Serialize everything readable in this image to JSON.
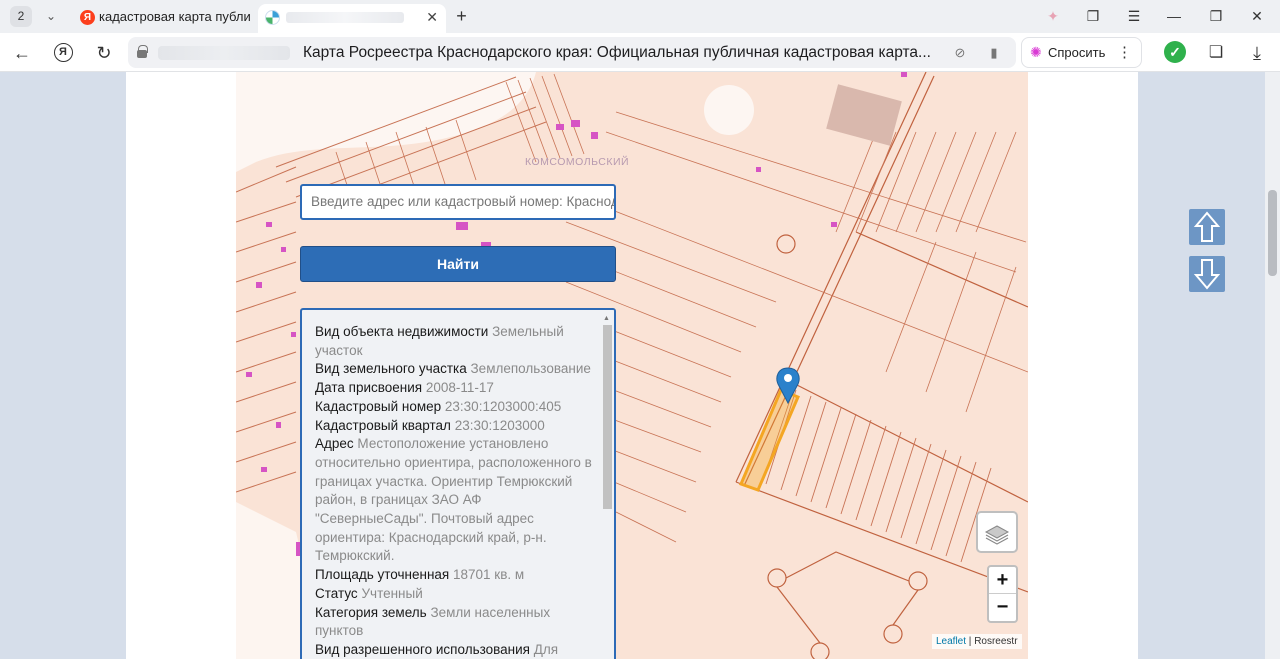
{
  "browser": {
    "tab_count": "2",
    "tabs": [
      {
        "label": "кадастровая карта публи"
      },
      {
        "label": ""
      }
    ],
    "address_title": "Карта Росреестра Краснодарского края: Официальная публичная кадастровая карта...",
    "ask_label": "Спросить"
  },
  "map": {
    "district_label": "КОМСОМОЛЬСКИЙ",
    "search": {
      "placeholder": "Введите адрес или кадастровый номер: Краснодар"
    },
    "find_button": "Найти",
    "attribution": {
      "leaflet": "Leaflet",
      "separator": " | ",
      "source": "Rosreestr"
    },
    "zoom_in": "+",
    "zoom_out": "−"
  },
  "info": {
    "rows": [
      {
        "label": "Вид объекта недвижимости",
        "value": "Земельный участок"
      },
      {
        "label": "Вид земельного участка",
        "value": "Землепользование"
      },
      {
        "label": "Дата присвоения",
        "value": "2008-11-17"
      },
      {
        "label": "Кадастровый номер",
        "value": "23:30:1203000:405"
      },
      {
        "label": "Кадастровый квартал",
        "value": "23:30:1203000"
      },
      {
        "label": "Адрес",
        "value": "Местоположение установлено относительно ориентира, расположенного в границах участка. Ориентир Темрюкский район, в границах ЗАО АФ \"СеверныеСады\". Почтовый адрес ориентира: Краснодарский край, р-н. Темрюкский."
      },
      {
        "label": "Площадь уточненная",
        "value": "18701 кв. м"
      },
      {
        "label": "Статус",
        "value": "Учтенный"
      },
      {
        "label": "Категория земель",
        "value": "Земли населенных пунктов"
      },
      {
        "label": "Вид разрешенного использования",
        "value": "Для"
      }
    ]
  },
  "colors": {
    "accent": "#2d6db6",
    "parcel_line": "#c0623f",
    "highlight": "#f4a623",
    "marker": "#2a81cb"
  }
}
